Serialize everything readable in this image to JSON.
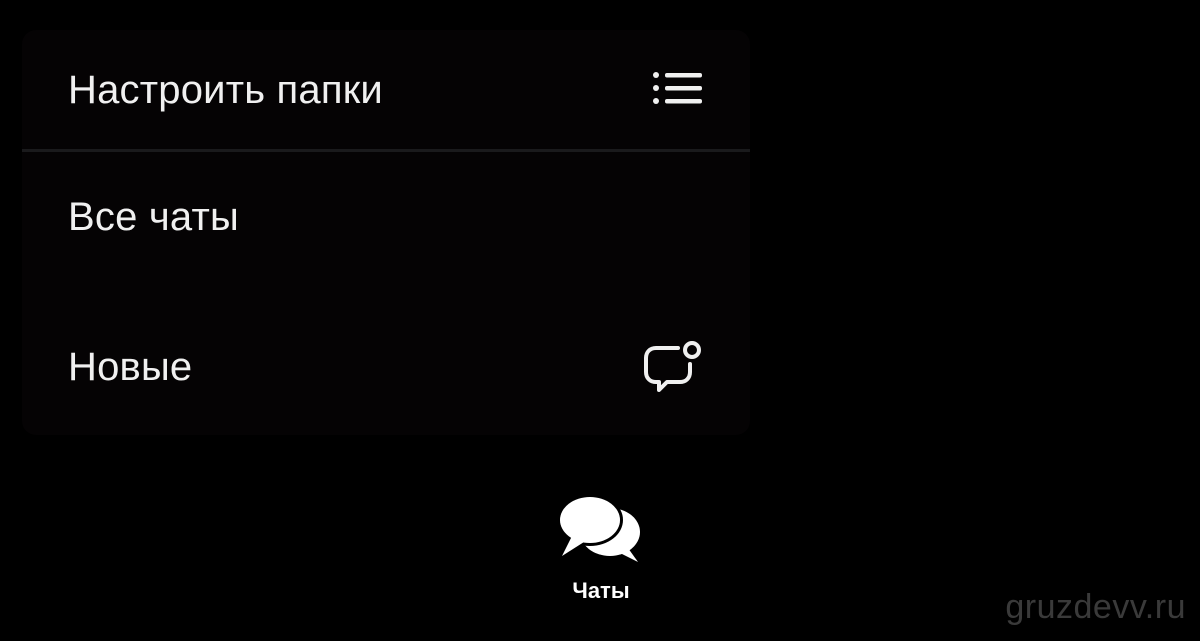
{
  "menu": {
    "items": [
      {
        "label": "Настроить папки",
        "icon": "list-icon"
      },
      {
        "label": "Все чаты"
      },
      {
        "label": "Новые",
        "icon": "chat-unread-icon"
      }
    ]
  },
  "tabbar": {
    "active_tab": {
      "label": "Чаты",
      "icon": "chats-icon"
    }
  },
  "watermark": "gruzdevv.ru",
  "colors": {
    "background": "#000000",
    "menu_background": "#050304",
    "divider": "#1a1a1c",
    "text": "#f0f0f0",
    "watermark": "#3a3a3a"
  }
}
